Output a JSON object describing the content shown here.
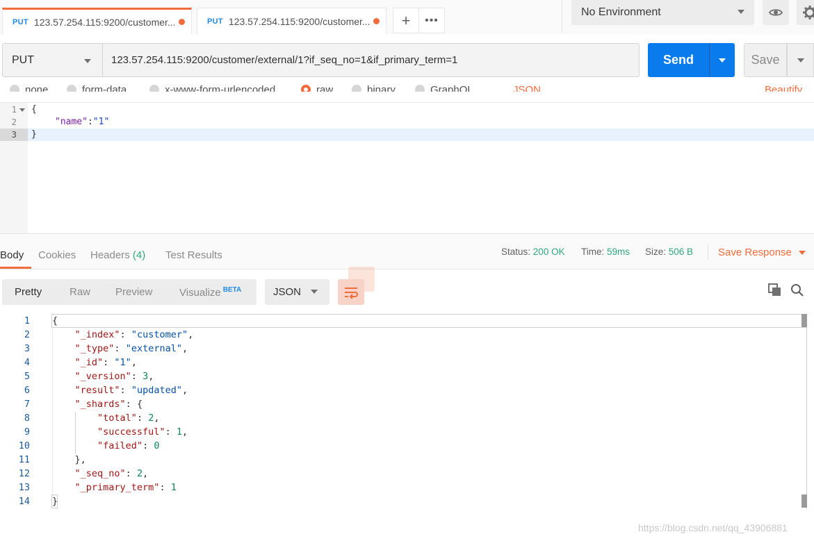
{
  "tabs": [
    {
      "method": "PUT",
      "title": "123.57.254.115:9200/customer..."
    },
    {
      "method": "PUT",
      "title": "123.57.254.115:9200/customer..."
    }
  ],
  "environment": {
    "selected": "No Environment"
  },
  "request": {
    "method": "PUT",
    "url": "123.57.254.115:9200/customer/external/1?if_seq_no=1&if_primary_term=1",
    "send_label": "Send",
    "save_label": "Save"
  },
  "body_types": {
    "options": [
      "none",
      "form-data",
      "x-www-form-urlencoded",
      "raw",
      "binary",
      "GraphQL"
    ],
    "selected": "raw",
    "language": "JSON",
    "beautify_label": "Beautify"
  },
  "request_body": {
    "lines": [
      {
        "num": "1",
        "code": "{"
      },
      {
        "num": "2",
        "key": "\"name\"",
        "value": "\"1\""
      },
      {
        "num": "3",
        "code": "}"
      }
    ]
  },
  "response": {
    "tabs": [
      {
        "label": "Body"
      },
      {
        "label": "Cookies"
      },
      {
        "label": "Headers",
        "count": "(4)"
      },
      {
        "label": "Test Results"
      }
    ],
    "status_label": "Status:",
    "status_value": "200 OK",
    "time_label": "Time:",
    "time_value": "59ms",
    "size_label": "Size:",
    "size_value": "506 B",
    "save_response_label": "Save Response",
    "views": [
      "Pretty",
      "Raw",
      "Preview",
      "Visualize"
    ],
    "visualize_badge": "BETA",
    "format": "JSON",
    "body_lines": [
      {
        "num": "1",
        "text": "{"
      },
      {
        "num": "2",
        "key": "\"_index\"",
        "value": "\"customer\"",
        "type": "s",
        "comma": ","
      },
      {
        "num": "3",
        "key": "\"_type\"",
        "value": "\"external\"",
        "type": "s",
        "comma": ","
      },
      {
        "num": "4",
        "key": "\"_id\"",
        "value": "\"1\"",
        "type": "s",
        "comma": ","
      },
      {
        "num": "5",
        "key": "\"_version\"",
        "value": "3",
        "type": "n",
        "comma": ","
      },
      {
        "num": "6",
        "key": "\"result\"",
        "value": "\"updated\"",
        "type": "s",
        "comma": ","
      },
      {
        "num": "7",
        "key": "\"_shards\"",
        "value": "{",
        "type": "p",
        "comma": ""
      },
      {
        "num": "8",
        "key": "\"total\"",
        "value": "2",
        "type": "n",
        "comma": ",",
        "indent": 2
      },
      {
        "num": "9",
        "key": "\"successful\"",
        "value": "1",
        "type": "n",
        "comma": ",",
        "indent": 2
      },
      {
        "num": "10",
        "key": "\"failed\"",
        "value": "0",
        "type": "n",
        "comma": "",
        "indent": 2
      },
      {
        "num": "11",
        "text": "    },"
      },
      {
        "num": "12",
        "key": "\"_seq_no\"",
        "value": "2",
        "type": "n",
        "comma": ","
      },
      {
        "num": "13",
        "key": "\"_primary_term\"",
        "value": "1",
        "type": "n",
        "comma": ""
      },
      {
        "num": "14",
        "text": "}"
      }
    ]
  },
  "watermark": "https://blog.csdn.net/qq_43906881",
  "colors": {
    "accent": "#f26b3a",
    "send": "#097bed",
    "success": "#2da87b"
  }
}
